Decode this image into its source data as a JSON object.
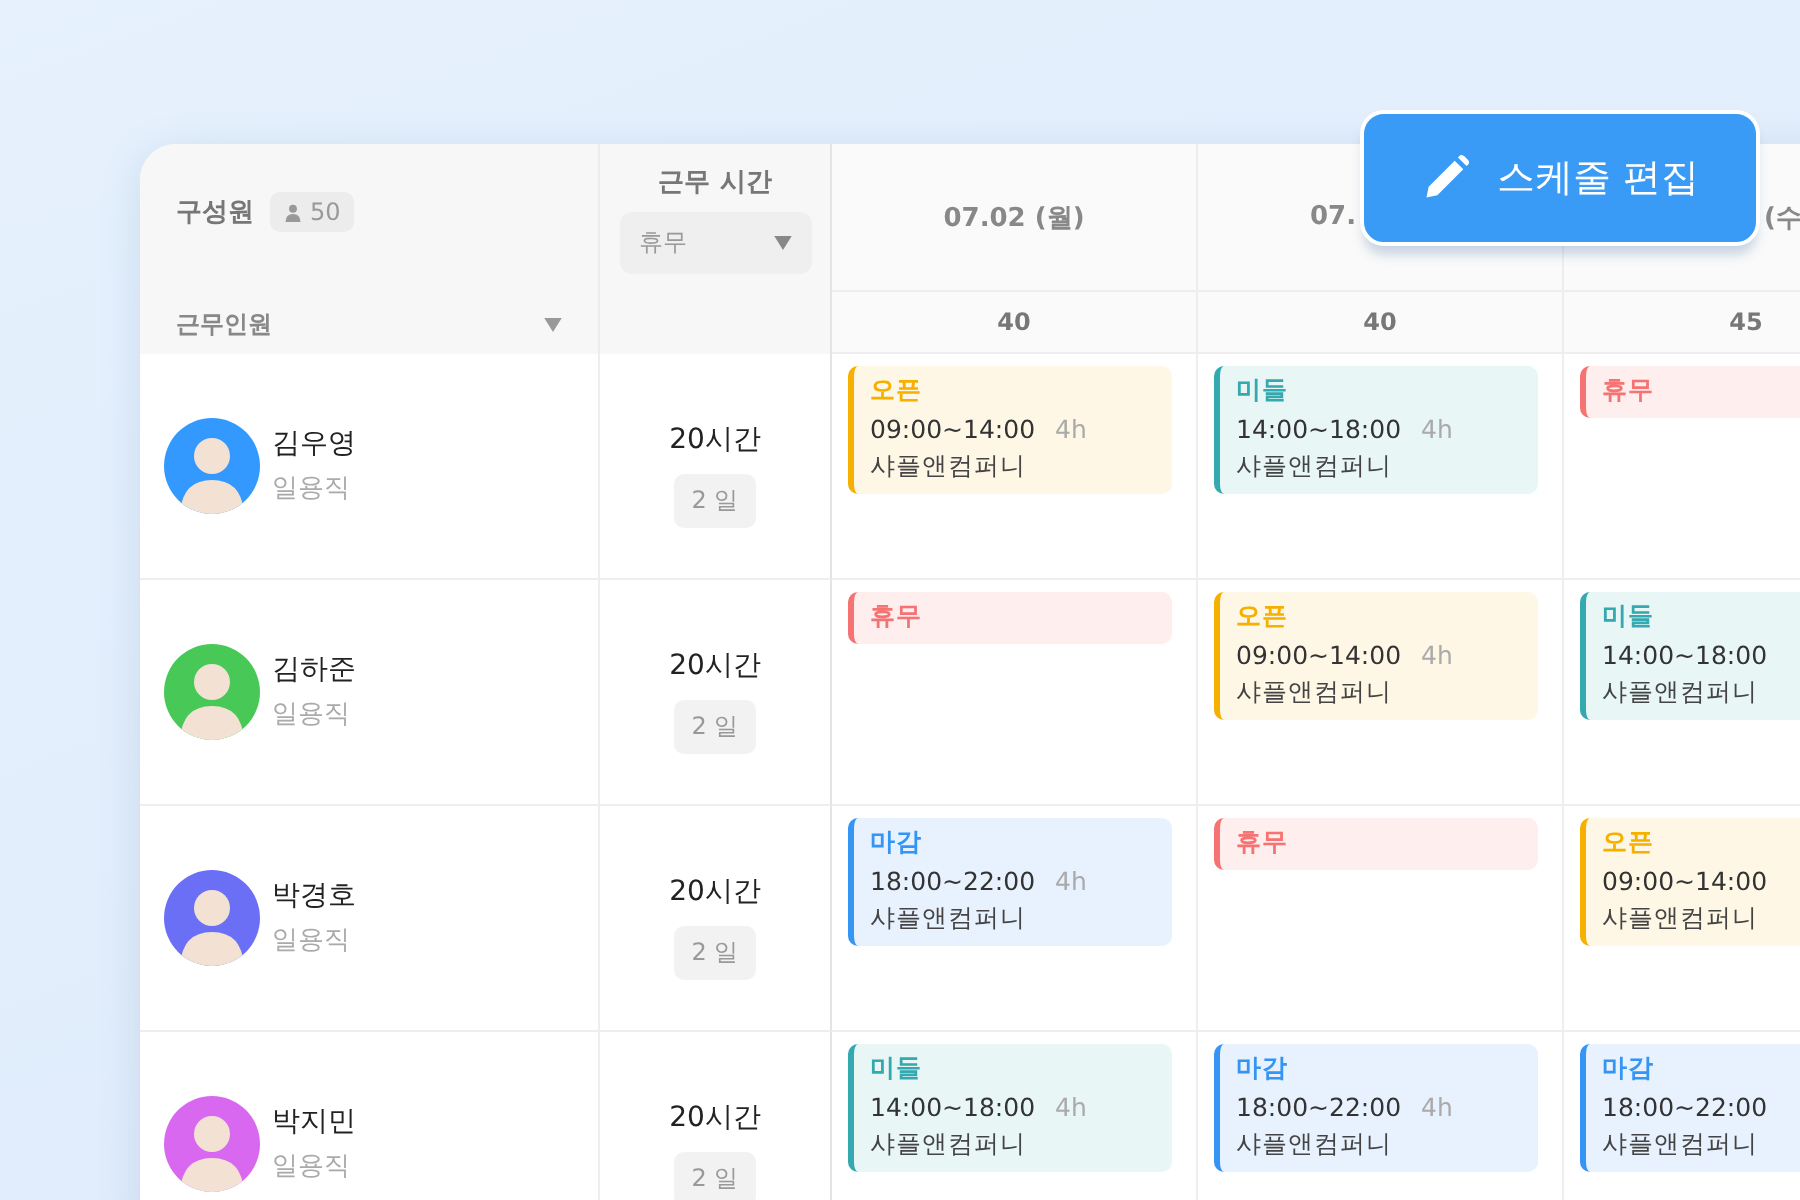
{
  "members_header": {
    "title": "구성원",
    "count": "50",
    "filter": "근무인원"
  },
  "hours_header": {
    "title": "근무 시간",
    "select": "휴무"
  },
  "days": [
    {
      "date": "07.02 (월)",
      "count": "40"
    },
    {
      "date": "07.",
      "count": "40"
    },
    {
      "date": "(수",
      "count": "45"
    }
  ],
  "edit_button": {
    "label": "스케줄 편집"
  },
  "members": [
    {
      "name": "김우영",
      "role": "일용직",
      "color": "#3399ff",
      "hours": "20시간",
      "days": "2 일",
      "shifts": [
        {
          "kind": "open",
          "label": "오픈",
          "time": "09:00~14:00",
          "duration": "4h",
          "place": "샤플앤컴퍼니"
        },
        {
          "kind": "middle",
          "label": "미들",
          "time": "14:00~18:00",
          "duration": "4h",
          "place": "샤플앤컴퍼니"
        },
        {
          "kind": "off",
          "label": "휴무"
        }
      ]
    },
    {
      "name": "김하준",
      "role": "일용직",
      "color": "#47c857",
      "hours": "20시간",
      "days": "2 일",
      "shifts": [
        {
          "kind": "off",
          "label": "휴무"
        },
        {
          "kind": "open",
          "label": "오픈",
          "time": "09:00~14:00",
          "duration": "4h",
          "place": "샤플앤컴퍼니"
        },
        {
          "kind": "middle",
          "label": "미들",
          "time": "14:00~18:00",
          "place": "샤플앤컴퍼니"
        }
      ]
    },
    {
      "name": "박경호",
      "role": "일용직",
      "color": "#6b6ff5",
      "hours": "20시간",
      "days": "2 일",
      "shifts": [
        {
          "kind": "close",
          "label": "마감",
          "time": "18:00~22:00",
          "duration": "4h",
          "place": "샤플앤컴퍼니"
        },
        {
          "kind": "off",
          "label": "휴무"
        },
        {
          "kind": "open",
          "label": "오픈",
          "time": "09:00~14:00",
          "place": "샤플앤컴퍼니"
        }
      ]
    },
    {
      "name": "박지민",
      "role": "일용직",
      "color": "#d868f0",
      "hours": "20시간",
      "days": "2 일",
      "shifts": [
        {
          "kind": "middle",
          "label": "미들",
          "time": "14:00~18:00",
          "duration": "4h",
          "place": "샤플앤컴퍼니"
        },
        {
          "kind": "close",
          "label": "마감",
          "time": "18:00~22:00",
          "duration": "4h",
          "place": "샤플앤컴퍼니"
        },
        {
          "kind": "close",
          "label": "마감",
          "time": "18:00~22:00",
          "place": "샤플앤컴퍼니"
        }
      ]
    }
  ]
}
